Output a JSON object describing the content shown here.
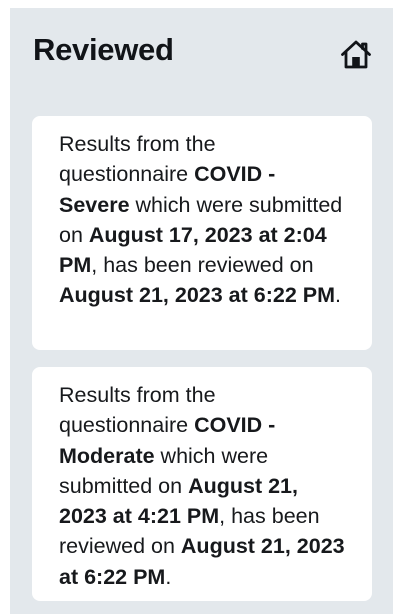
{
  "header": {
    "title": "Reviewed",
    "home_icon": "home-icon"
  },
  "notifications": [
    {
      "prefix": "Results from the questionnaire ",
      "questionnaire": "COVID - Severe",
      "submitted_text": " which were submitted on ",
      "submitted_at": "August 17, 2023 at 2:04 PM",
      "reviewed_text": ", has been reviewed on ",
      "reviewed_at": "August 21, 2023 at 6:22 PM",
      "suffix": "."
    },
    {
      "prefix": "Results from the questionnaire ",
      "questionnaire": "COVID - Moderate",
      "submitted_text": " which were submitted on ",
      "submitted_at": "August 21, 2023 at 4:21 PM",
      "reviewed_text": ", has been reviewed on ",
      "reviewed_at": "August 21, 2023 at 6:22 PM",
      "suffix": "."
    }
  ],
  "colors": {
    "panel_background": "#e3e8ec",
    "card_background": "#ffffff",
    "text": "#17191c"
  }
}
